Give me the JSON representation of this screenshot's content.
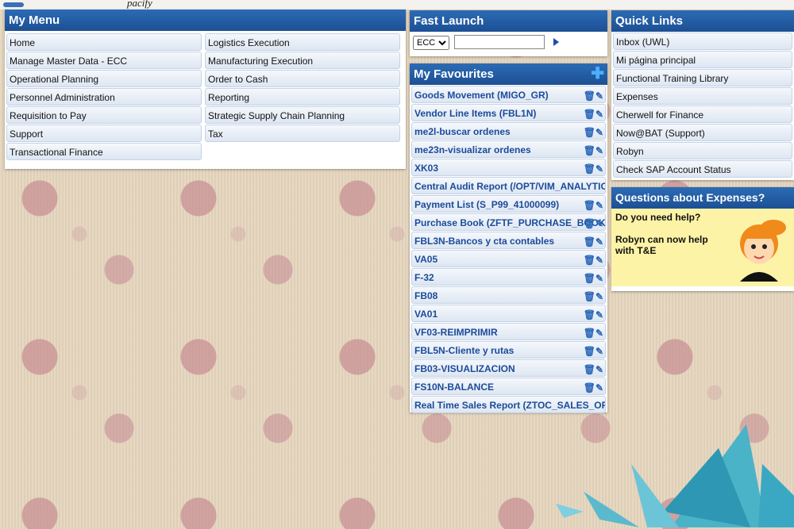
{
  "top_strip": {
    "text": "pacify"
  },
  "my_menu": {
    "title": "My Menu",
    "left": [
      "Home",
      "Manage Master Data - ECC",
      "Operational Planning",
      "Personnel Administration",
      "Requisition to Pay",
      "Support",
      "Transactional Finance"
    ],
    "right": [
      "Logistics Execution",
      "Manufacturing Execution",
      "Order to Cash",
      "Reporting",
      "Strategic Supply Chain Planning",
      "Tax"
    ]
  },
  "fast_launch": {
    "title": "Fast Launch",
    "system": "ECC",
    "input_value": ""
  },
  "favourites": {
    "title": "My Favourites",
    "items": [
      {
        "label": "Goods Movement (MIGO_GR)",
        "actions": true
      },
      {
        "label": "Vendor Line Items (FBL1N)",
        "actions": true
      },
      {
        "label": "me2l-buscar ordenes",
        "actions": true
      },
      {
        "label": "me23n-visualizar ordenes",
        "actions": true
      },
      {
        "label": "XK03",
        "actions": true
      },
      {
        "label": "Central Audit Report (/OPT/VIM_ANALYTIC",
        "actions": false
      },
      {
        "label": "Payment List (S_P99_41000099)",
        "actions": true
      },
      {
        "label": "Purchase Book (ZFTF_PURCHASE_BOOK)",
        "actions": true
      },
      {
        "label": "FBL3N-Bancos y cta contables",
        "actions": true
      },
      {
        "label": "VA05",
        "actions": true
      },
      {
        "label": "F-32",
        "actions": true
      },
      {
        "label": "FB08",
        "actions": true
      },
      {
        "label": "VA01",
        "actions": true
      },
      {
        "label": "VF03-REIMPRIMIR",
        "actions": true
      },
      {
        "label": "FBL5N-Cliente y rutas",
        "actions": true
      },
      {
        "label": "FB03-VISUALIZACION",
        "actions": true
      },
      {
        "label": "FS10N-BALANCE",
        "actions": true
      },
      {
        "label": "Real Time Sales Report (ZTOC_SALES_ORDE",
        "actions": false
      }
    ]
  },
  "quick_links": {
    "title": "Quick Links",
    "items": [
      "Inbox (UWL)",
      "Mi página principal",
      "Functional Training Library",
      "Expenses",
      "Cherwell for Finance",
      "Now@BAT (Support)",
      "Robyn",
      "Check SAP Account Status"
    ]
  },
  "expenses": {
    "title": "Questions about Expenses?",
    "line1": "Do you need help?",
    "line2": "Robyn can now help",
    "line3": "with T&E"
  },
  "icons": {
    "fav_actions": "trash-edit-icons",
    "add": "plus-icon"
  }
}
